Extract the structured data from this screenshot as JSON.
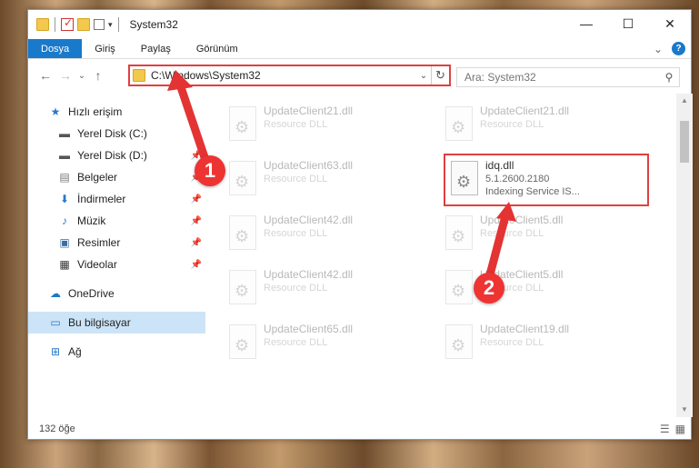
{
  "window": {
    "title": "System32",
    "controls": {
      "minimize": "—",
      "maximize": "☐",
      "close": "✕"
    }
  },
  "ribbon": {
    "tabs": [
      "Dosya",
      "Giriş",
      "Paylaş",
      "Görünüm"
    ],
    "help": "?",
    "expand": "⌄"
  },
  "navigation": {
    "back": "←",
    "forward": "→",
    "recent": "⌄",
    "up": "↑",
    "address": "C:\\Windows\\System32",
    "search_placeholder": "Ara: System32"
  },
  "sidebar": {
    "items": [
      {
        "label": "Hızlı erişim",
        "icon": "star-icon",
        "pinned": false
      },
      {
        "label": "Yerel Disk (C:)",
        "icon": "drive-icon",
        "pinned": false
      },
      {
        "label": "Yerel Disk (D:)",
        "icon": "drive-icon",
        "pinned": true
      },
      {
        "label": "Belgeler",
        "icon": "documents-icon",
        "pinned": true
      },
      {
        "label": "İndirmeler",
        "icon": "download-icon",
        "pinned": true
      },
      {
        "label": "Müzik",
        "icon": "music-icon",
        "pinned": true
      },
      {
        "label": "Resimler",
        "icon": "pictures-icon",
        "pinned": true
      },
      {
        "label": "Videolar",
        "icon": "videos-icon",
        "pinned": true
      },
      {
        "label": "OneDrive",
        "icon": "cloud-icon",
        "pinned": false
      },
      {
        "label": "Bu bilgisayar",
        "icon": "computer-icon",
        "pinned": false
      },
      {
        "label": "Ağ",
        "icon": "network-icon",
        "pinned": false
      }
    ]
  },
  "files": [
    {
      "name": "UpdateClient21.dll",
      "desc": "Resource DLL",
      "faded": true
    },
    {
      "name": "UpdateClient21.dll",
      "desc": "Resource DLL",
      "faded": true
    },
    {
      "name": "UpdateClient63.dll",
      "desc": "Resource DLL",
      "faded": true
    },
    {
      "name": "idq.dll",
      "version": "5.1.2600.2180",
      "desc": "Indexing Service IS...",
      "faded": false
    },
    {
      "name": "UpdateClient42.dll",
      "desc": "Resource DLL",
      "faded": true
    },
    {
      "name": "UpdateClient5.dll",
      "desc": "Resource DLL",
      "faded": true
    },
    {
      "name": "UpdateClient42.dll",
      "desc": "Resource DLL",
      "faded": true
    },
    {
      "name": "UpdateClient5.dll",
      "desc": "Resource DLL",
      "faded": true
    },
    {
      "name": "UpdateClient65.dll",
      "desc": "Resource DLL",
      "faded": true
    },
    {
      "name": "UpdateClient19.dll",
      "desc": "Resource DLL",
      "faded": true
    }
  ],
  "status": {
    "count": "132 öğe"
  },
  "annotations": {
    "step1": "1",
    "step2": "2",
    "color": "#e33333"
  }
}
